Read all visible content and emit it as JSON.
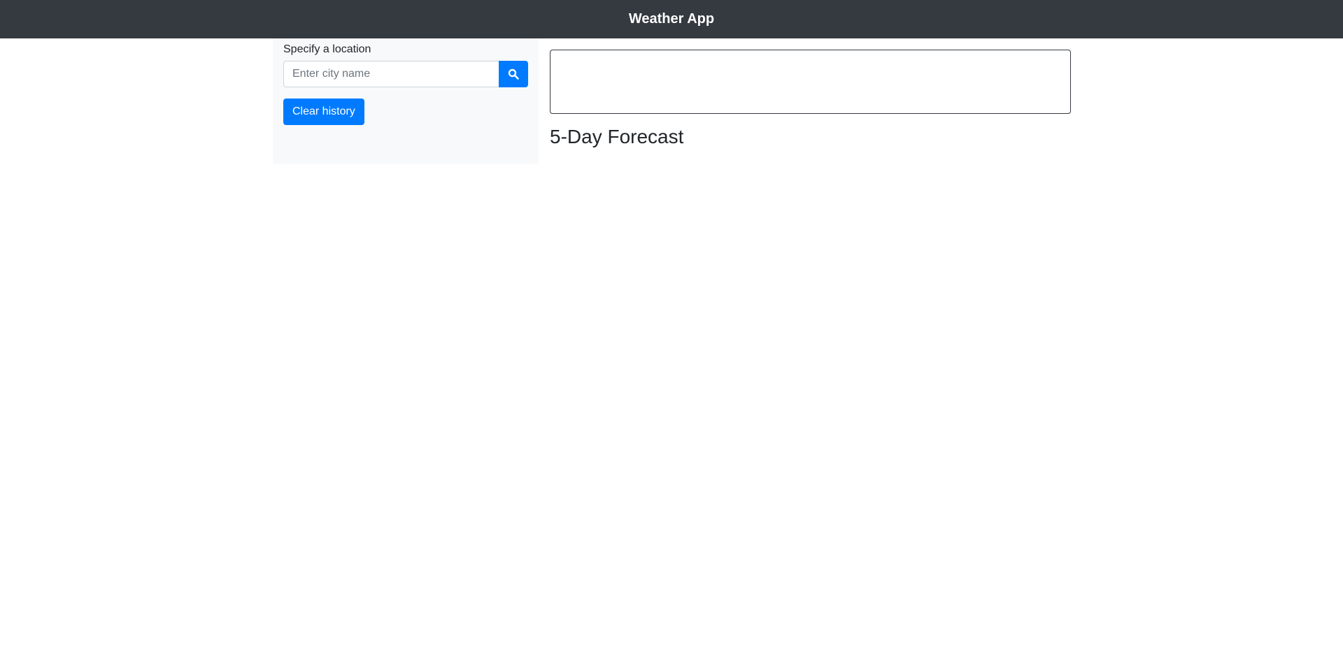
{
  "app": {
    "title": "Weather App"
  },
  "sidebar": {
    "location_label": "Specify a location",
    "search_placeholder": "Enter city name",
    "search_value": "",
    "search_icon": "search-icon",
    "clear_history_label": "Clear history"
  },
  "main": {
    "forecast_heading": "5-Day Forecast"
  },
  "colors": {
    "navbar": "#343a40",
    "primary": "#007bff",
    "sidebar_bg": "#f8f9fa"
  }
}
